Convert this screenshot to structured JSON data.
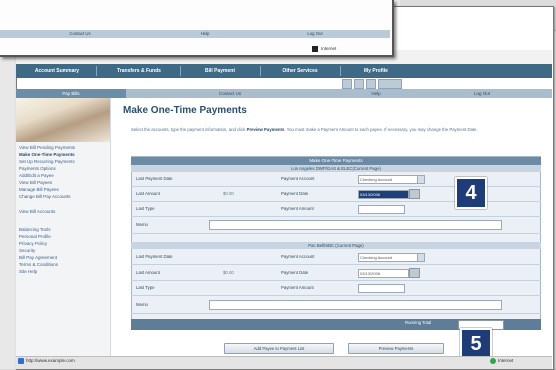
{
  "popup": {
    "nav": [
      "Contact Us",
      "Help",
      "Log Out"
    ],
    "status": "Internet"
  },
  "mainnav": [
    "Account Summary",
    "Transfers & Funds",
    "Bill Payment",
    "Other Services",
    "My Profile"
  ],
  "subnav": [
    "Pay Bills",
    "Contact Us",
    "Help",
    "Log Out"
  ],
  "sidebar": {
    "links": [
      "View Bill Pending Payments",
      "Make One-Time Payments",
      "Set Up Recurring Payments",
      "Payments Options",
      "Add/Edit a Payee",
      "View Bill Payees",
      "Manage Bill Payees",
      "Change Bill Pay Accounts",
      "",
      "View Bill Accounts",
      "",
      "Balancing Tools",
      "Personal Profile",
      "Privacy Policy",
      "Security",
      "Bill Pay Agreement",
      "Terms & Conditions",
      "Site Help"
    ]
  },
  "page": {
    "title": "Make One-Time Payments",
    "intro_part1": "Select the accounts, type the payment information, and click",
    "intro_bold": "Preview Payments",
    "intro_part2": ". You must make a Payment Amount to each payee. If necessary, you may change the Payment Date."
  },
  "form": {
    "header": "Make One-Time Payments",
    "payee1": {
      "subheader": "Los Angeles DWP/GAS & ELEC(Current Page)",
      "last_payment_date_label": "Last Payment Date",
      "pay_from_label": "Payment Account",
      "pay_from_value": "Checking Account",
      "last_amount_label": "Last Amount",
      "last_amount_value": "$0.00",
      "payment_date_label": "Payment Date",
      "payment_date_value": "03/13/2006",
      "last_type_label": "Last Type",
      "payment_amount_label": "Payment Amount",
      "memo_label": "Memo"
    },
    "payee2": {
      "subheader": "Pac Bell/SBC (Current Page)",
      "last_payment_date_label": "Last Payment Date",
      "pay_from_label": "Payment Account",
      "pay_from_value": "Checking Account",
      "last_amount_label": "Last Amount",
      "last_amount_value": "$0.00",
      "payment_date_label": "Payment Date",
      "payment_date_value": "03/13/2006",
      "last_type_label": "Last Type",
      "payment_amount_label": "Payment Amount",
      "memo_label": "Memo"
    },
    "total_label": "Running Total",
    "btn_add": "Add Payee to Payment List",
    "btn_preview": "Preview Payments"
  },
  "callouts": {
    "c4": "4",
    "c5": "5"
  },
  "status": {
    "text": "http://www.example.com",
    "zone": "Internet"
  }
}
